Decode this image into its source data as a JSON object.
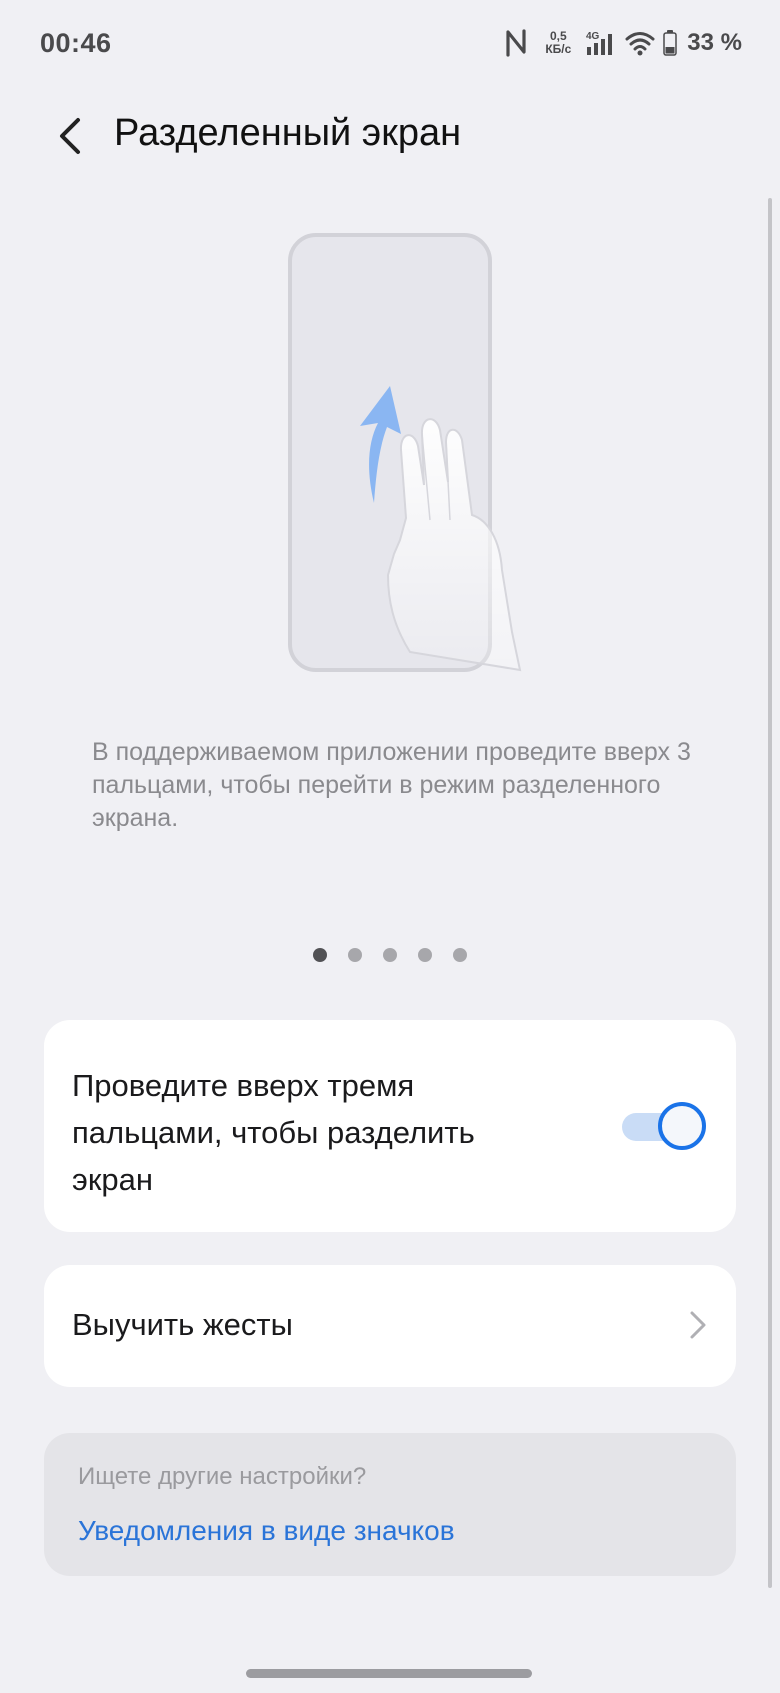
{
  "status_bar": {
    "time": "00:46",
    "speed_value": "0,5",
    "speed_unit": "КБ/с",
    "network_type": "4G",
    "battery": "33 %",
    "icons": [
      "nfc-icon",
      "signal-icon",
      "wifi-icon",
      "battery-icon"
    ]
  },
  "header": {
    "title": "Разделенный экран",
    "back_icon": "chevron-left-icon"
  },
  "tutorial": {
    "description": "В поддерживаемом приложении проведите вверх 3 пальцами, чтобы перейти в режим разделенного экрана.",
    "page_count": 5,
    "active_page": 1
  },
  "toggle_card": {
    "label": "Проведите вверх тремя пальцами, чтобы разделить экран",
    "enabled": true
  },
  "gestures_card": {
    "label": "Выучить жесты"
  },
  "more_card": {
    "hint": "Ищете другие настройки?",
    "link": "Уведомления в виде значков"
  },
  "colors": {
    "background": "#f0f0f4",
    "accent": "#1a73e8",
    "link": "#2a74d8"
  }
}
